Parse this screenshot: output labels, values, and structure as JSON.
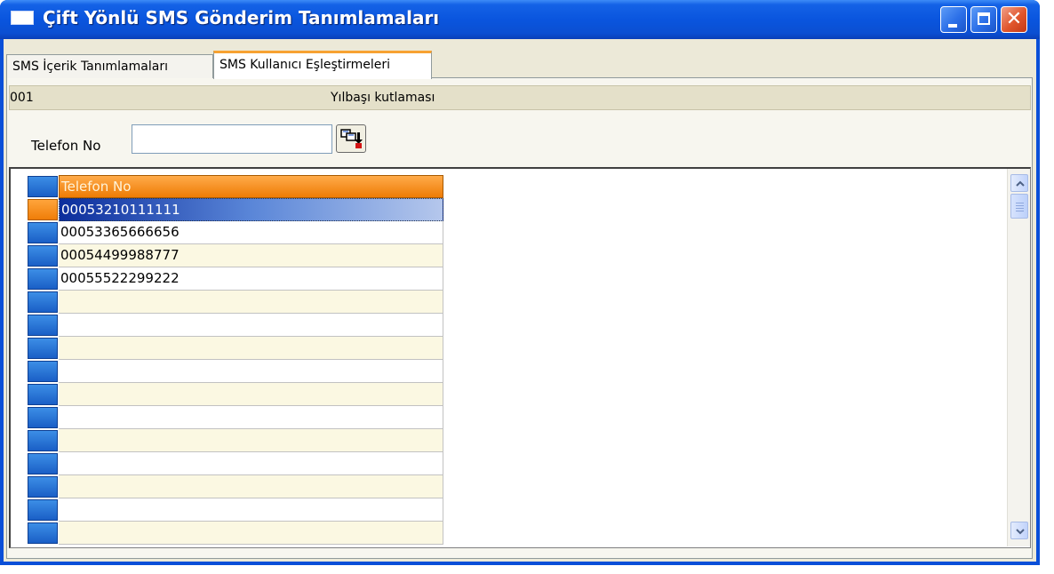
{
  "window": {
    "title": "Çift Yönlü SMS Gönderim Tanımlamaları",
    "close_glyph": "✕",
    "colors": {
      "titlebar": "#0a55de",
      "accent": "#f7a232",
      "selected_row": "#0b2d9c"
    }
  },
  "tabs": [
    {
      "label": "SMS İçerik Tanımlamaları",
      "active": false
    },
    {
      "label": "SMS Kullanıcı Eşleştirmeleri",
      "active": true
    }
  ],
  "info": {
    "code": "001",
    "description": "Yılbaşı kutlaması"
  },
  "filter": {
    "label": "Telefon No",
    "value": "",
    "placeholder": ""
  },
  "grid": {
    "header": "Telefon No",
    "rows": [
      "00053210111111",
      "00053365666656",
      "00054499988777",
      "00055522299222",
      "",
      "",
      "",
      "",
      "",
      "",
      "",
      "",
      "",
      "",
      ""
    ],
    "selected_index": 0
  },
  "icons": {
    "window": "window-icon",
    "lookup": "lookup-copy-icon",
    "scroll_up": "chevron-up-icon",
    "scroll_down": "chevron-down-icon"
  }
}
